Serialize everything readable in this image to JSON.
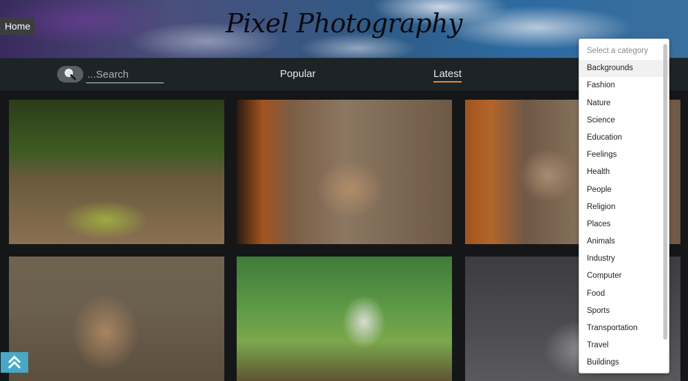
{
  "header": {
    "home_label": "Home",
    "site_title": "Pixel Photography"
  },
  "nav": {
    "search_placeholder": "...Search",
    "popular_label": "Popular",
    "latest_label": "Latest",
    "active_tab": "Latest",
    "accent_color": "#f08a2c"
  },
  "gallery": {
    "photos": [
      {
        "subject": "deer-in-forest"
      },
      {
        "subject": "deer-feeding-by-fence"
      },
      {
        "subject": "deer-feeding-by-fence"
      },
      {
        "subject": "fawn-with-hand"
      },
      {
        "subject": "white-horse-in-field"
      },
      {
        "subject": "watering-can-with-flowers"
      }
    ]
  },
  "category_dropdown": {
    "placeholder": "Select a category",
    "highlighted": "Backgrounds",
    "options": [
      "Backgrounds",
      "Fashion",
      "Nature",
      "Science",
      "Education",
      "Feelings",
      "Health",
      "People",
      "Religion",
      "Places",
      "Animals",
      "Industry",
      "Computer",
      "Food",
      "Sports",
      "Transportation",
      "Travel",
      "Buildings"
    ]
  },
  "icons": {
    "search": "search-icon",
    "scroll_top": "double-chevron-up-icon"
  }
}
